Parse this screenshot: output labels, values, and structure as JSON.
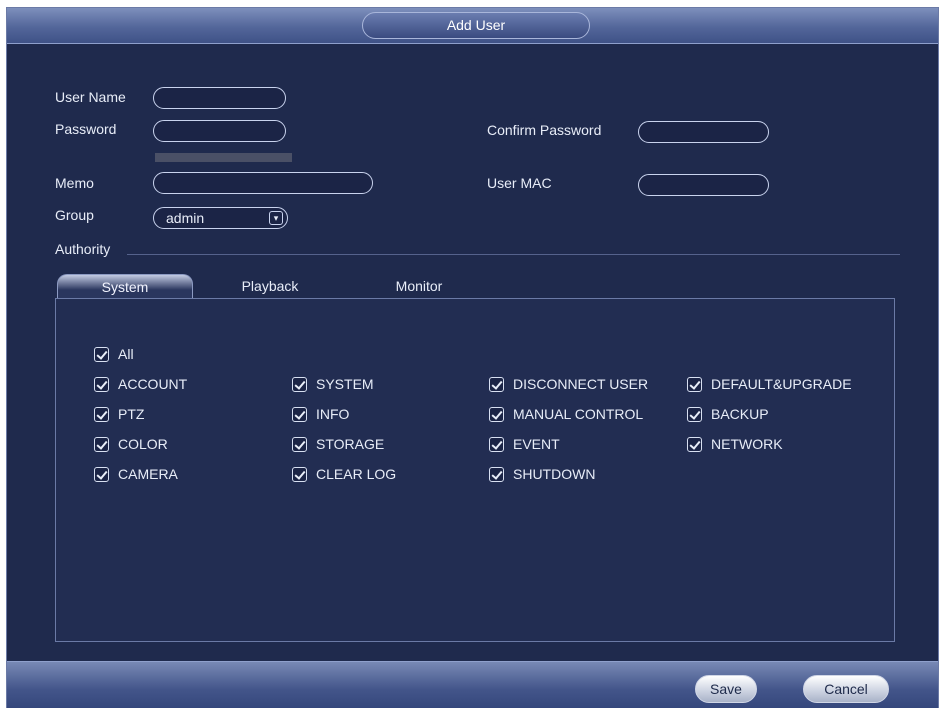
{
  "dialog": {
    "title": "Add User"
  },
  "form": {
    "user_name_label": "User Name",
    "password_label": "Password",
    "confirm_password_label": "Confirm Password",
    "memo_label": "Memo",
    "user_mac_label": "User MAC",
    "group_label": "Group",
    "group_value": "admin",
    "authority_label": "Authority"
  },
  "tabs": [
    {
      "label": "System",
      "active": true
    },
    {
      "label": "Playback",
      "active": false
    },
    {
      "label": "Monitor",
      "active": false
    }
  ],
  "permissions": {
    "all": "All",
    "col1": [
      "ACCOUNT",
      "PTZ",
      "COLOR",
      "CAMERA"
    ],
    "col2": [
      "SYSTEM",
      "INFO",
      "STORAGE",
      "CLEAR LOG"
    ],
    "col3": [
      "DISCONNECT USER",
      "MANUAL CONTROL",
      "EVENT",
      "SHUTDOWN"
    ],
    "col4": [
      "DEFAULT&UPGRADE",
      "BACKUP",
      "NETWORK"
    ]
  },
  "buttons": {
    "save": "Save",
    "cancel": "Cancel"
  }
}
